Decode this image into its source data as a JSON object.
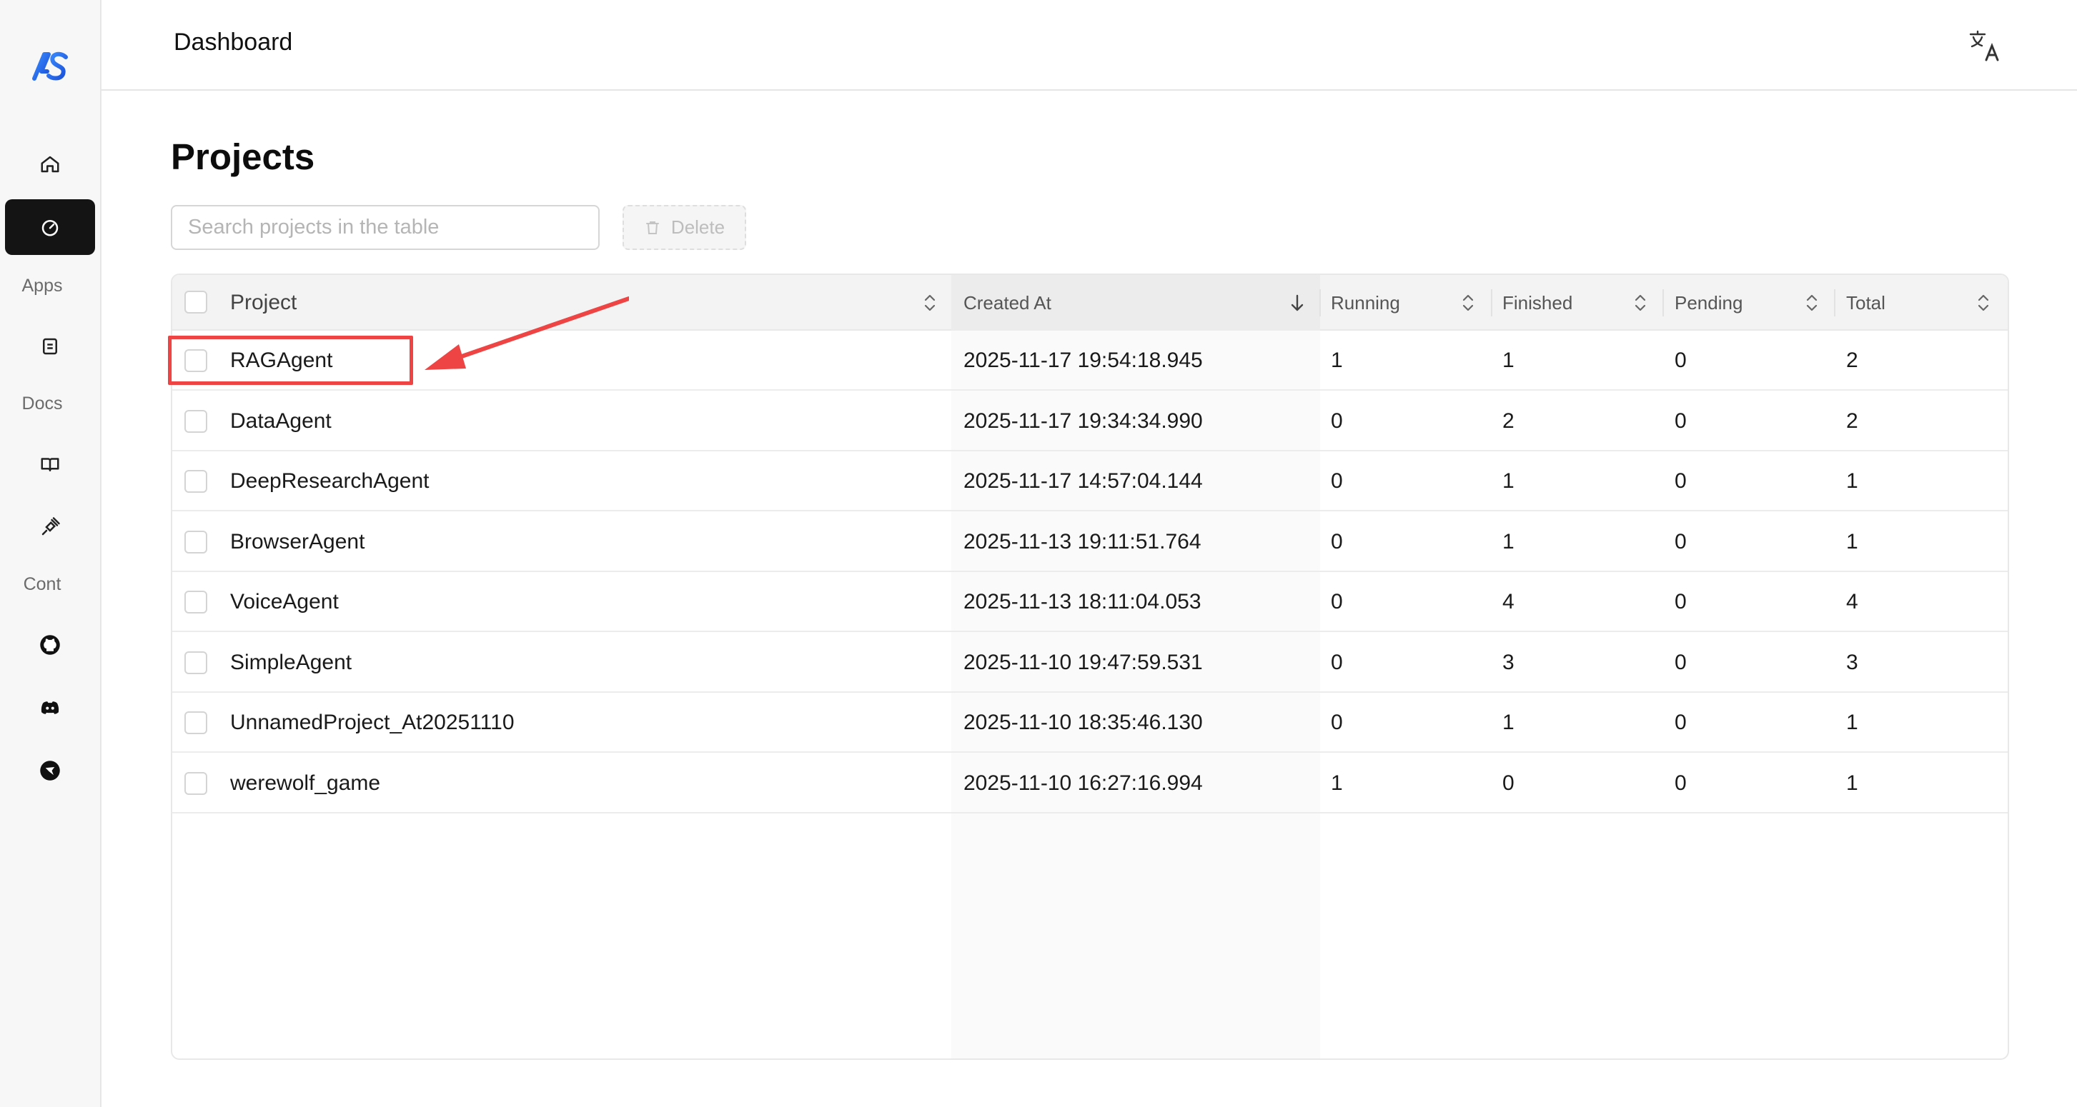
{
  "header": {
    "title": "Dashboard"
  },
  "sidebar": {
    "sections": {
      "apps": "Apps",
      "docs": "Docs",
      "cont": "Cont"
    },
    "icons": [
      "home-icon",
      "dashboard-icon",
      "app-icon",
      "book-icon",
      "plug-icon",
      "github-icon",
      "discord-icon",
      "bird-icon"
    ]
  },
  "page": {
    "title": "Projects"
  },
  "search": {
    "placeholder": "Search projects in the table",
    "value": ""
  },
  "toolbar": {
    "delete_label": "Delete"
  },
  "table": {
    "columns": [
      "Project",
      "Created At",
      "Running",
      "Finished",
      "Pending",
      "Total"
    ],
    "sorted_column": "Created At",
    "sort_direction": "desc",
    "rows": [
      {
        "project": "RAGAgent",
        "created_at": "2025-11-17 19:54:18.945",
        "running": "1",
        "finished": "1",
        "pending": "0",
        "total": "2"
      },
      {
        "project": "DataAgent",
        "created_at": "2025-11-17 19:34:34.990",
        "running": "0",
        "finished": "2",
        "pending": "0",
        "total": "2"
      },
      {
        "project": "DeepResearchAgent",
        "created_at": "2025-11-17 14:57:04.144",
        "running": "0",
        "finished": "1",
        "pending": "0",
        "total": "1"
      },
      {
        "project": "BrowserAgent",
        "created_at": "2025-11-13 19:11:51.764",
        "running": "0",
        "finished": "1",
        "pending": "0",
        "total": "1"
      },
      {
        "project": "VoiceAgent",
        "created_at": "2025-11-13 18:11:04.053",
        "running": "0",
        "finished": "4",
        "pending": "0",
        "total": "4"
      },
      {
        "project": "SimpleAgent",
        "created_at": "2025-11-10 19:47:59.531",
        "running": "0",
        "finished": "3",
        "pending": "0",
        "total": "3"
      },
      {
        "project": "UnnamedProject_At20251110",
        "created_at": "2025-11-10 18:35:46.130",
        "running": "0",
        "finished": "1",
        "pending": "0",
        "total": "1"
      },
      {
        "project": "werewolf_game",
        "created_at": "2025-11-10 16:27:16.994",
        "running": "1",
        "finished": "0",
        "pending": "0",
        "total": "1"
      }
    ]
  },
  "colors": {
    "accent_dark": "#141414",
    "annotation_red": "#ee4444",
    "logo_blue": "#2a6ff0"
  }
}
